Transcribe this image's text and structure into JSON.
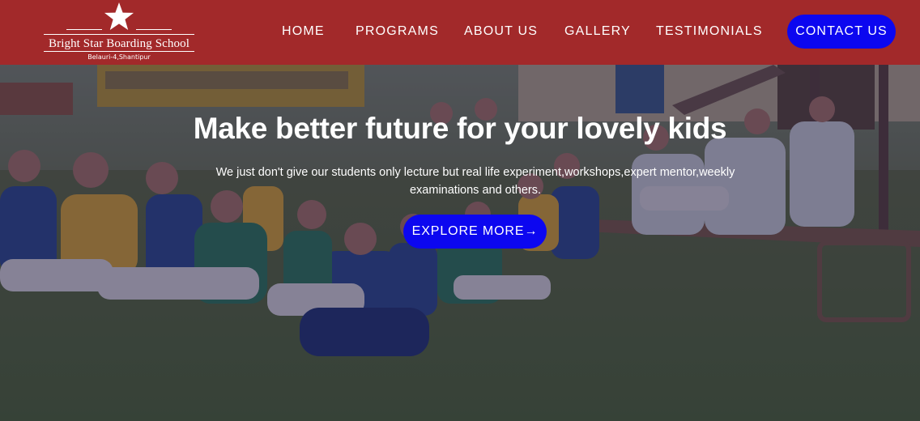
{
  "header": {
    "logo": {
      "name": "Bright Star Boarding School",
      "location": "Belauri-4,Shantipur"
    },
    "nav": [
      {
        "label": "HOME"
      },
      {
        "label": "PROGRAMS"
      },
      {
        "label": "ABOUT US"
      },
      {
        "label": "GALLERY"
      },
      {
        "label": "TESTIMONIALS"
      }
    ],
    "contact_label": "CONTACT US"
  },
  "hero": {
    "title": "Make better future for your lovely kids",
    "subtitle": "We just don't give our students only lecture but real life experiment,workshops,expert mentor,weekly examinations and others.",
    "cta_label": "EXPLORE MORE→"
  },
  "colors": {
    "header_bg": "#a2292a",
    "button_bg": "#0c07f0",
    "text": "#ffffff"
  }
}
